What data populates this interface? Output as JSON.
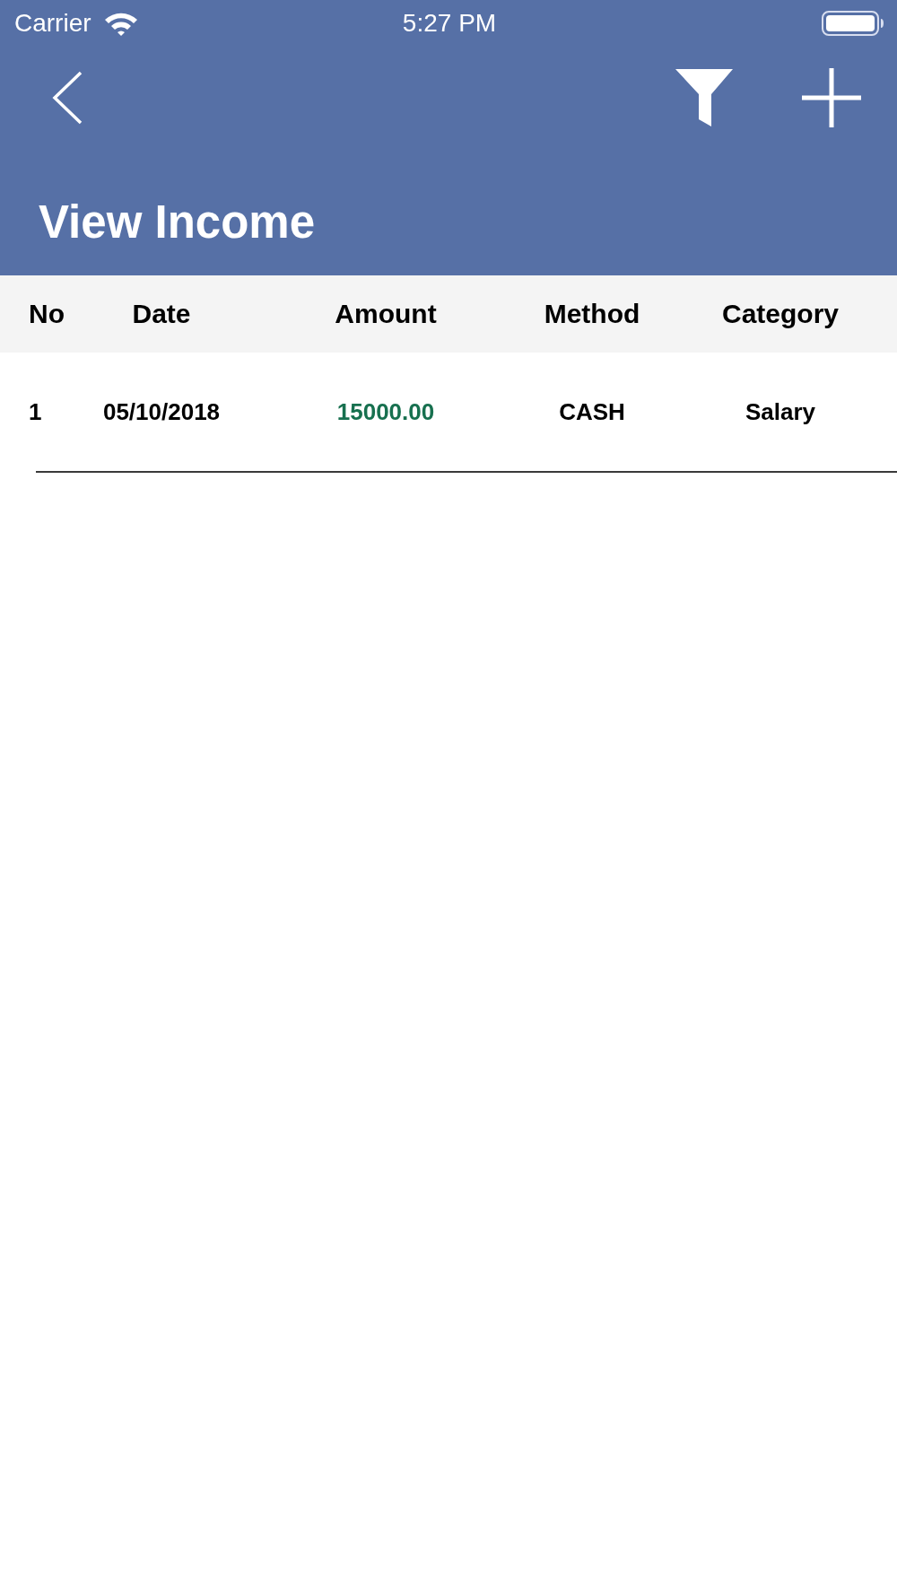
{
  "status_bar": {
    "carrier": "Carrier",
    "time": "5:27 PM"
  },
  "nav_bar": {
    "title": "View Income"
  },
  "table": {
    "columns": [
      "No",
      "Date",
      "Amount",
      "Method",
      "Category"
    ],
    "rows": [
      {
        "cells": [
          "1",
          "05/10/2018",
          "15000.00",
          "CASH",
          "Salary"
        ]
      }
    ]
  }
}
